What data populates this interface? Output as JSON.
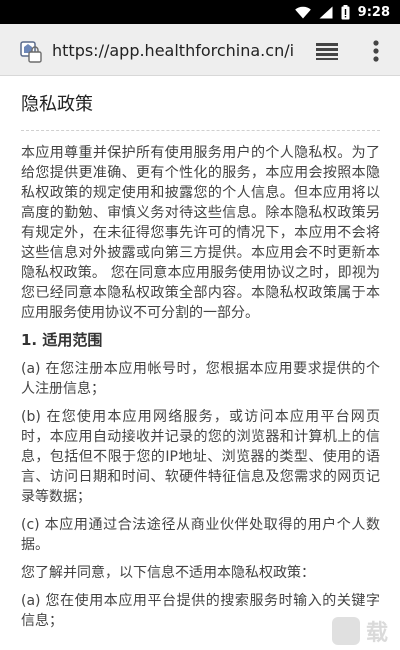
{
  "status_bar": {
    "time": "9:28",
    "icons": [
      "wifi-icon",
      "signal-icon",
      "battery-icon"
    ]
  },
  "browser": {
    "url": "https://app.healthforchina.cn/i",
    "icons": [
      "site-favicon-icon",
      "tabs-switcher-icon",
      "overflow-menu-icon"
    ]
  },
  "page": {
    "title": "隐私政策",
    "intro": "本应用尊重并保护所有使用服务用户的个人隐私权。为了给您提供更准确、更有个性化的服务，本应用会按照本隐私权政策的规定使用和披露您的个人信息。但本应用将以高度的勤勉、审慎义务对待这些信息。除本隐私权政策另有规定外，在未征得您事先许可的情况下，本应用不会将这些信息对外披露或向第三方提供。本应用会不时更新本隐私权政策。 您在同意本应用服务使用协议之时，即视为您已经同意本隐私权政策全部内容。本隐私权政策属于本应用服务使用协议不可分割的一部分。",
    "section1_heading": "1. 适用范围",
    "section1_items": [
      "(a) 在您注册本应用帐号时，您根据本应用要求提供的个人注册信息；",
      "(b) 在您使用本应用网络服务，或访问本应用平台网页时，本应用自动接收并记录的您的浏览器和计算机上的信息，包括但不限于您的IP地址、浏览器的类型、使用的语言、访问日期和时间、软硬件特征信息及您需求的网页记录等数据；",
      "(c) 本应用通过合法途径从商业伙伴处取得的用户个人数据。"
    ],
    "exclusion_intro": "您了解并同意，以下信息不适用本隐私权政策：",
    "exclusion_items": [
      "(a) 您在使用本应用平台提供的搜索服务时输入的关键字信息；"
    ]
  },
  "watermark": {
    "text": "载"
  }
}
